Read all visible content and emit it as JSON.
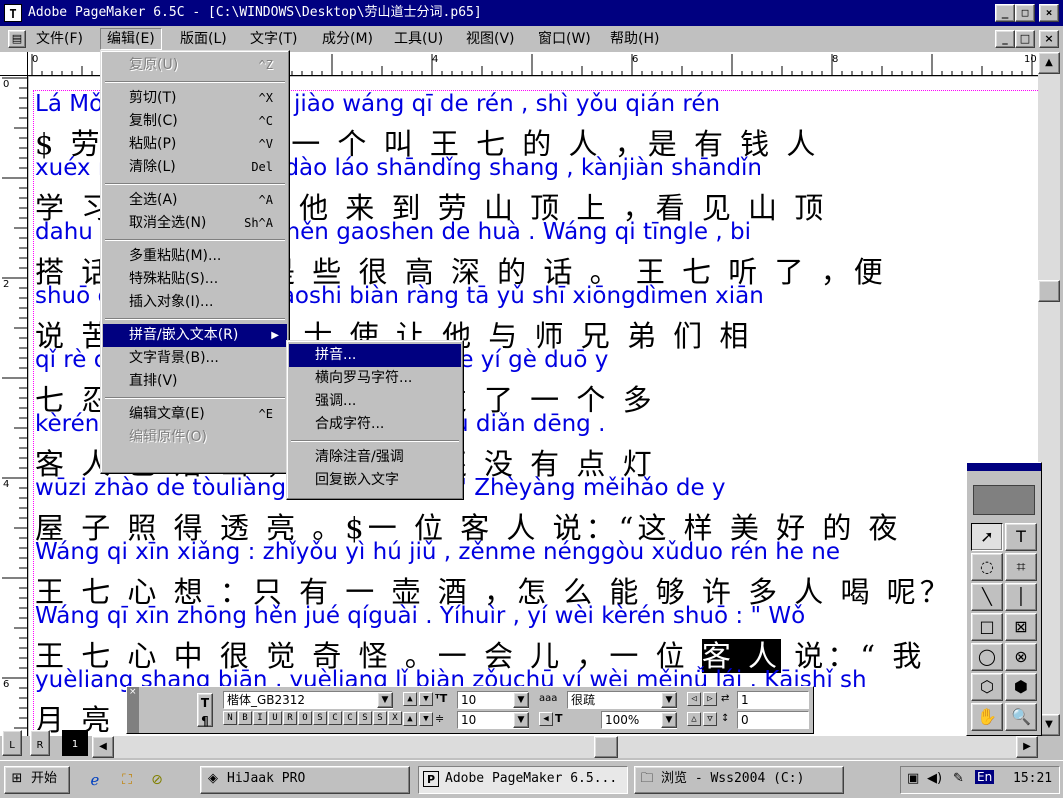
{
  "window": {
    "title": "Adobe PageMaker 6.5C - [C:\\WINDOWS\\Desktop\\劳山道士分词.p65]",
    "app_icon": "T",
    "caption_buttons": [
      "_",
      "□",
      "×"
    ]
  },
  "menubar": {
    "items": [
      "文件(F)",
      "编辑(E)",
      "版面(L)",
      "文字(T)",
      "成分(M)",
      "工具(U)",
      "视图(V)",
      "窗口(W)",
      "帮助(H)"
    ],
    "doc_buttons": [
      "_",
      "□",
      "×"
    ]
  },
  "rulers": {
    "h_labels": [
      "0",
      "2",
      "4",
      "6",
      "8",
      "10"
    ],
    "v_labels": [
      "0",
      "2",
      "4",
      "6"
    ]
  },
  "edit_menu": {
    "items": [
      {
        "label": "复原(U)",
        "shortcut": "^Z",
        "disabled": true
      },
      {
        "sep": true
      },
      {
        "label": "剪切(T)",
        "shortcut": "^X"
      },
      {
        "label": "复制(C)",
        "shortcut": "^C"
      },
      {
        "label": "粘贴(P)",
        "shortcut": "^V"
      },
      {
        "label": "清除(L)",
        "shortcut": "Del"
      },
      {
        "sep": true
      },
      {
        "label": "全选(A)",
        "shortcut": "^A"
      },
      {
        "label": "取消全选(N)",
        "shortcut": "Sh^A"
      },
      {
        "sep": true
      },
      {
        "label": "多重粘贴(M)...",
        "shortcut": ""
      },
      {
        "label": "特殊粘贴(S)...",
        "shortcut": ""
      },
      {
        "label": "插入对象(I)...",
        "shortcut": ""
      },
      {
        "sep": true
      },
      {
        "label": "拼音/嵌入文本(R)",
        "shortcut": "",
        "submenu": true,
        "highlight": true
      },
      {
        "label": "文字背景(B)...",
        "shortcut": ""
      },
      {
        "label": "直排(V)",
        "shortcut": ""
      },
      {
        "sep": true
      },
      {
        "label": "编辑文章(E)",
        "shortcut": "^E"
      },
      {
        "label": "编辑原件(O)",
        "shortcut": "",
        "disabled": true
      }
    ]
  },
  "submenu": {
    "items": [
      {
        "label": "拼音...",
        "highlight": true
      },
      {
        "label": "横向罗马字符..."
      },
      {
        "label": "强调..."
      },
      {
        "label": "合成字符..."
      },
      {
        "sep": true
      },
      {
        "label": "清除注音/强调"
      },
      {
        "label": "回复嵌入文字"
      }
    ]
  },
  "document": {
    "lines": [
      {
        "type": "pinyin",
        "text": "Lá                                  Mǒu xiàn yǒu  yí  gè jiào wáng  qī  de rén  , shì yǒu qián rén"
      },
      {
        "type": "hanzi",
        "text": "$ 劳              $ 某 县 有 一 个 叫  王 七 的 人 ，是 有 钱 人"
      },
      {
        "type": "pinyin",
        "text": "xuéx              nò  yì  tiān  ,  tā  láidào láo shāndǐng shang  ,  kànjiàn shāndǐn"
      },
      {
        "type": "hanzi",
        "text": "学 习            这 一 天 ，他 来 到 劳  山  顶   上  ，看 见  山  顶"
      },
      {
        "type": "pinyin",
        "text": "dahu             zuǐ  lǐ  dou shìxie hěn gaoshen de huà . Wáng qi  tīngle  , bi"
      },
      {
        "type": "hanzi",
        "text": "搭 话            嘴 里 都 是 些  很  高  深 的 话 。 王  七 听 了 ，便"
      },
      {
        "type": "pinyin",
        "text": "shuō             chīkǔ  de  .\"  Nà dàoshi biàn ràng tā  yǔ  shī xiōngdìmen xiān"
      },
      {
        "type": "hanzi",
        "text": " 说              苦 的 。”那 道 士  使  让 他 与 师 兄  弟  们  相"
      },
      {
        "type": "pinyin",
        "text": "qǐ  rè              oqiú rènzhēn qù kǎn chái . Guòle  yí  gè duō y"
      },
      {
        "type": "hanzi",
        "text": "七 忍              求 认 真 去 砍 柴 。过 了 一 个  多"
      },
      {
        "type": "pinyin",
        "text": "kèrén              jǐ  luò shān  ,  kě wū  lǐ  hái méiyǒu diǎn dēng ."
      },
      {
        "type": "hanzi",
        "text": "客 人              已 落  山 ，可 屋 里 还 没 有 点   灯"
      },
      {
        "type": "pinyin",
        "text": " wūzi  zhào de tòuliàng              ì kèrén shuō : \" Zhèyàng měihǎo de y"
      },
      {
        "type": "hanzi",
        "text": "屋 子  照  得 透  亮 。$一 位 客 人  说：“这  样  美 好 的 夜"
      },
      {
        "type": "pinyin",
        "text": "Wáng qi xīn xiǎng : zhǐyǒu  yì  hú  jiǔ  , zěnme nénggòu xǔduo rén he ne"
      },
      {
        "type": "hanzi",
        "text": " 王  七 心  想 ：只 有 一 壶 酒 ，怎 么  能   够  许 多 人 喝 呢？"
      },
      {
        "type": "pinyin",
        "text": "Wáng qī xīn zhōng hěn jué qíguài .   Yíhuìr    ,  yí  wèi kèrén shuō : \" Wǒ"
      },
      {
        "type": "hanzi",
        "text": " 王  七 心   中   很 觉 奇 怪 。一 会 儿 ，一 位 ",
        "selected": "客 人",
        "rest": " 说：“ 我"
      },
      {
        "type": "pinyin",
        "text": "yuèliang shang biān  ,  yuèliang  lǐ  biàn zǒuchū  yí  wèi měinǚ lái . Kāishǐ sh"
      },
      {
        "type": "hanzi",
        "text": "月  亮                                                          。开 始 是"
      }
    ]
  },
  "control_palette": {
    "font": "楷体_GB2312",
    "size": "10",
    "leading": "10",
    "tracking": "很疏",
    "width": "100%",
    "kerning": "1",
    "baseline": "0",
    "style_buttons": [
      "N",
      "B",
      "I",
      "U",
      "R",
      "O",
      "S",
      "C",
      "C",
      "S",
      "S",
      "X"
    ]
  },
  "toolbox": {
    "tools": [
      "pointer-tool",
      "text-tool",
      "rotate-tool",
      "crop-tool",
      "line-tool",
      "constrained-line-tool",
      "rectangle-tool",
      "rectangle-frame-tool",
      "ellipse-tool",
      "ellipse-frame-tool",
      "polygon-tool",
      "polygon-frame-tool",
      "hand-tool",
      "zoom-tool"
    ],
    "glyphs": [
      "➚",
      "T",
      "◌",
      "⌗",
      "╲",
      "│",
      "□",
      "⊠",
      "◯",
      "⊗",
      "⬡",
      "⬢",
      "✋",
      "🔍"
    ]
  },
  "page_icons": [
    "L",
    "R",
    "1"
  ],
  "taskbar": {
    "start": "开始",
    "tasks": [
      "HiJaak PRO",
      "Adobe PageMaker 6.5...",
      "浏览 - Wss2004 (C:)"
    ],
    "lang": "En",
    "clock": "15:21"
  }
}
